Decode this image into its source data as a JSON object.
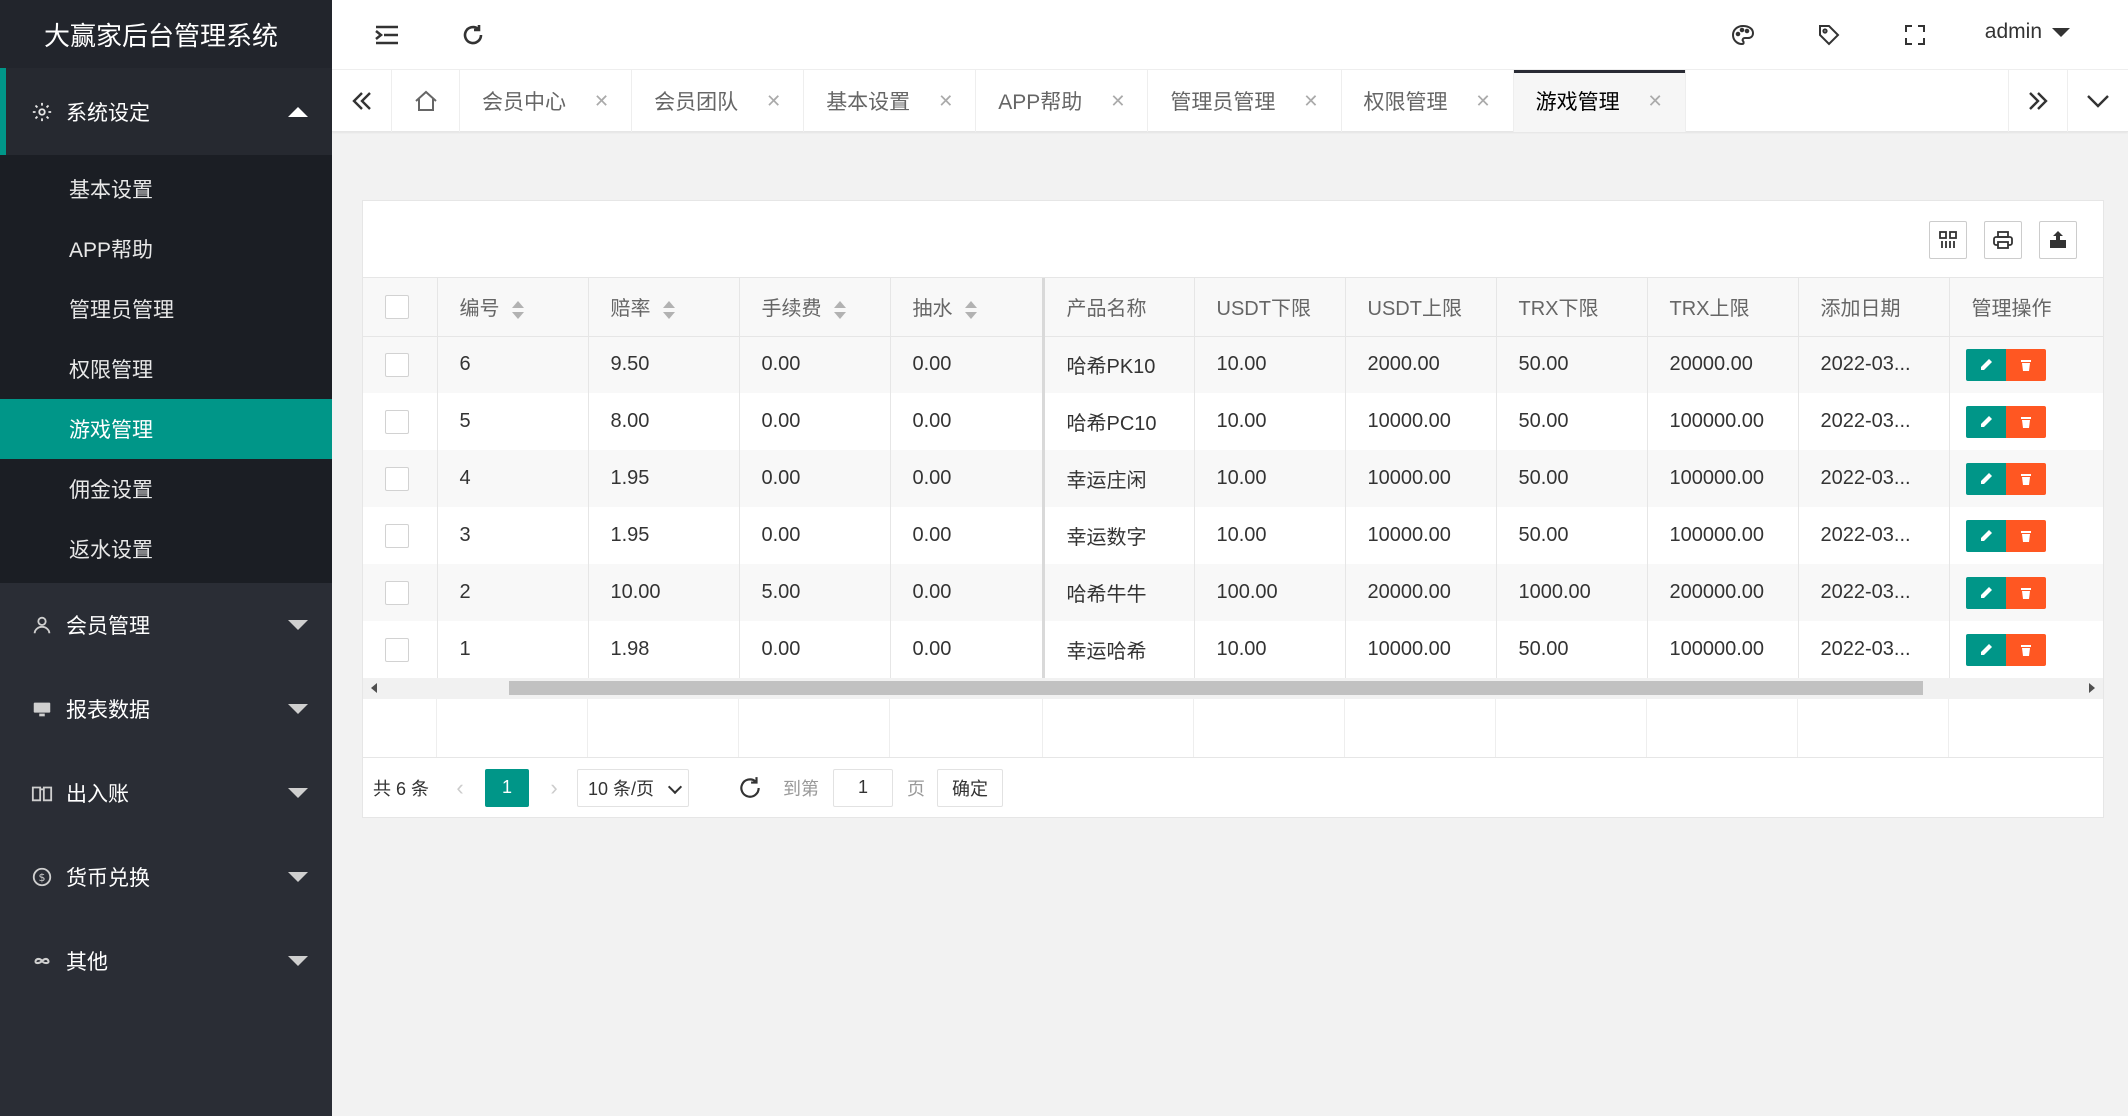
{
  "brand": "大赢家后台管理系统",
  "sidebar": {
    "active_group": {
      "label": "系统设定",
      "icon": "gear-icon",
      "items": [
        {
          "label": "基本设置",
          "active": false
        },
        {
          "label": "APP帮助",
          "active": false
        },
        {
          "label": "管理员管理",
          "active": false
        },
        {
          "label": "权限管理",
          "active": false
        },
        {
          "label": "游戏管理",
          "active": true
        },
        {
          "label": "佣金设置",
          "active": false
        },
        {
          "label": "返水设置",
          "active": false
        }
      ]
    },
    "groups": [
      {
        "label": "会员管理",
        "icon": "user-icon"
      },
      {
        "label": "报表数据",
        "icon": "monitor-icon"
      },
      {
        "label": "出入账",
        "icon": "book-icon"
      },
      {
        "label": "货币兑换",
        "icon": "dollar-icon"
      },
      {
        "label": "其他",
        "icon": "infinity-icon"
      }
    ]
  },
  "header": {
    "user": "admin"
  },
  "tabs": [
    {
      "label": "会员中心",
      "active": false
    },
    {
      "label": "会员团队",
      "active": false
    },
    {
      "label": "基本设置",
      "active": false
    },
    {
      "label": "APP帮助",
      "active": false
    },
    {
      "label": "管理员管理",
      "active": false
    },
    {
      "label": "权限管理",
      "active": false
    },
    {
      "label": "游戏管理",
      "active": true
    }
  ],
  "table": {
    "columns": [
      "编号",
      "赔率",
      "手续费",
      "抽水",
      "产品名称",
      "USDT下限",
      "USDT上限",
      "TRX下限",
      "TRX上限",
      "添加日期",
      "管理操作"
    ],
    "rows": [
      [
        "6",
        "9.50",
        "0.00",
        "0.00",
        "哈希PK10",
        "10.00",
        "2000.00",
        "50.00",
        "20000.00",
        "2022-03..."
      ],
      [
        "5",
        "8.00",
        "0.00",
        "0.00",
        "哈希PC10",
        "10.00",
        "10000.00",
        "50.00",
        "100000.00",
        "2022-03..."
      ],
      [
        "4",
        "1.95",
        "0.00",
        "0.00",
        "幸运庄闲",
        "10.00",
        "10000.00",
        "50.00",
        "100000.00",
        "2022-03..."
      ],
      [
        "3",
        "1.95",
        "0.00",
        "0.00",
        "幸运数字",
        "10.00",
        "10000.00",
        "50.00",
        "100000.00",
        "2022-03..."
      ],
      [
        "2",
        "10.00",
        "5.00",
        "0.00",
        "哈希牛牛",
        "100.00",
        "20000.00",
        "1000.00",
        "200000.00",
        "2022-03..."
      ],
      [
        "1",
        "1.98",
        "0.00",
        "0.00",
        "幸运哈希",
        "10.00",
        "10000.00",
        "50.00",
        "100000.00",
        "2022-03..."
      ]
    ]
  },
  "pager": {
    "total": "共 6 条",
    "current": "1",
    "limit": "10 条/页",
    "goto_label": "到第",
    "goto_value": "1",
    "page_label": "页",
    "confirm": "确定"
  },
  "colors": {
    "accent": "#009688",
    "danger": "#ff5722",
    "sidebar_bg": "#2a2d35"
  }
}
